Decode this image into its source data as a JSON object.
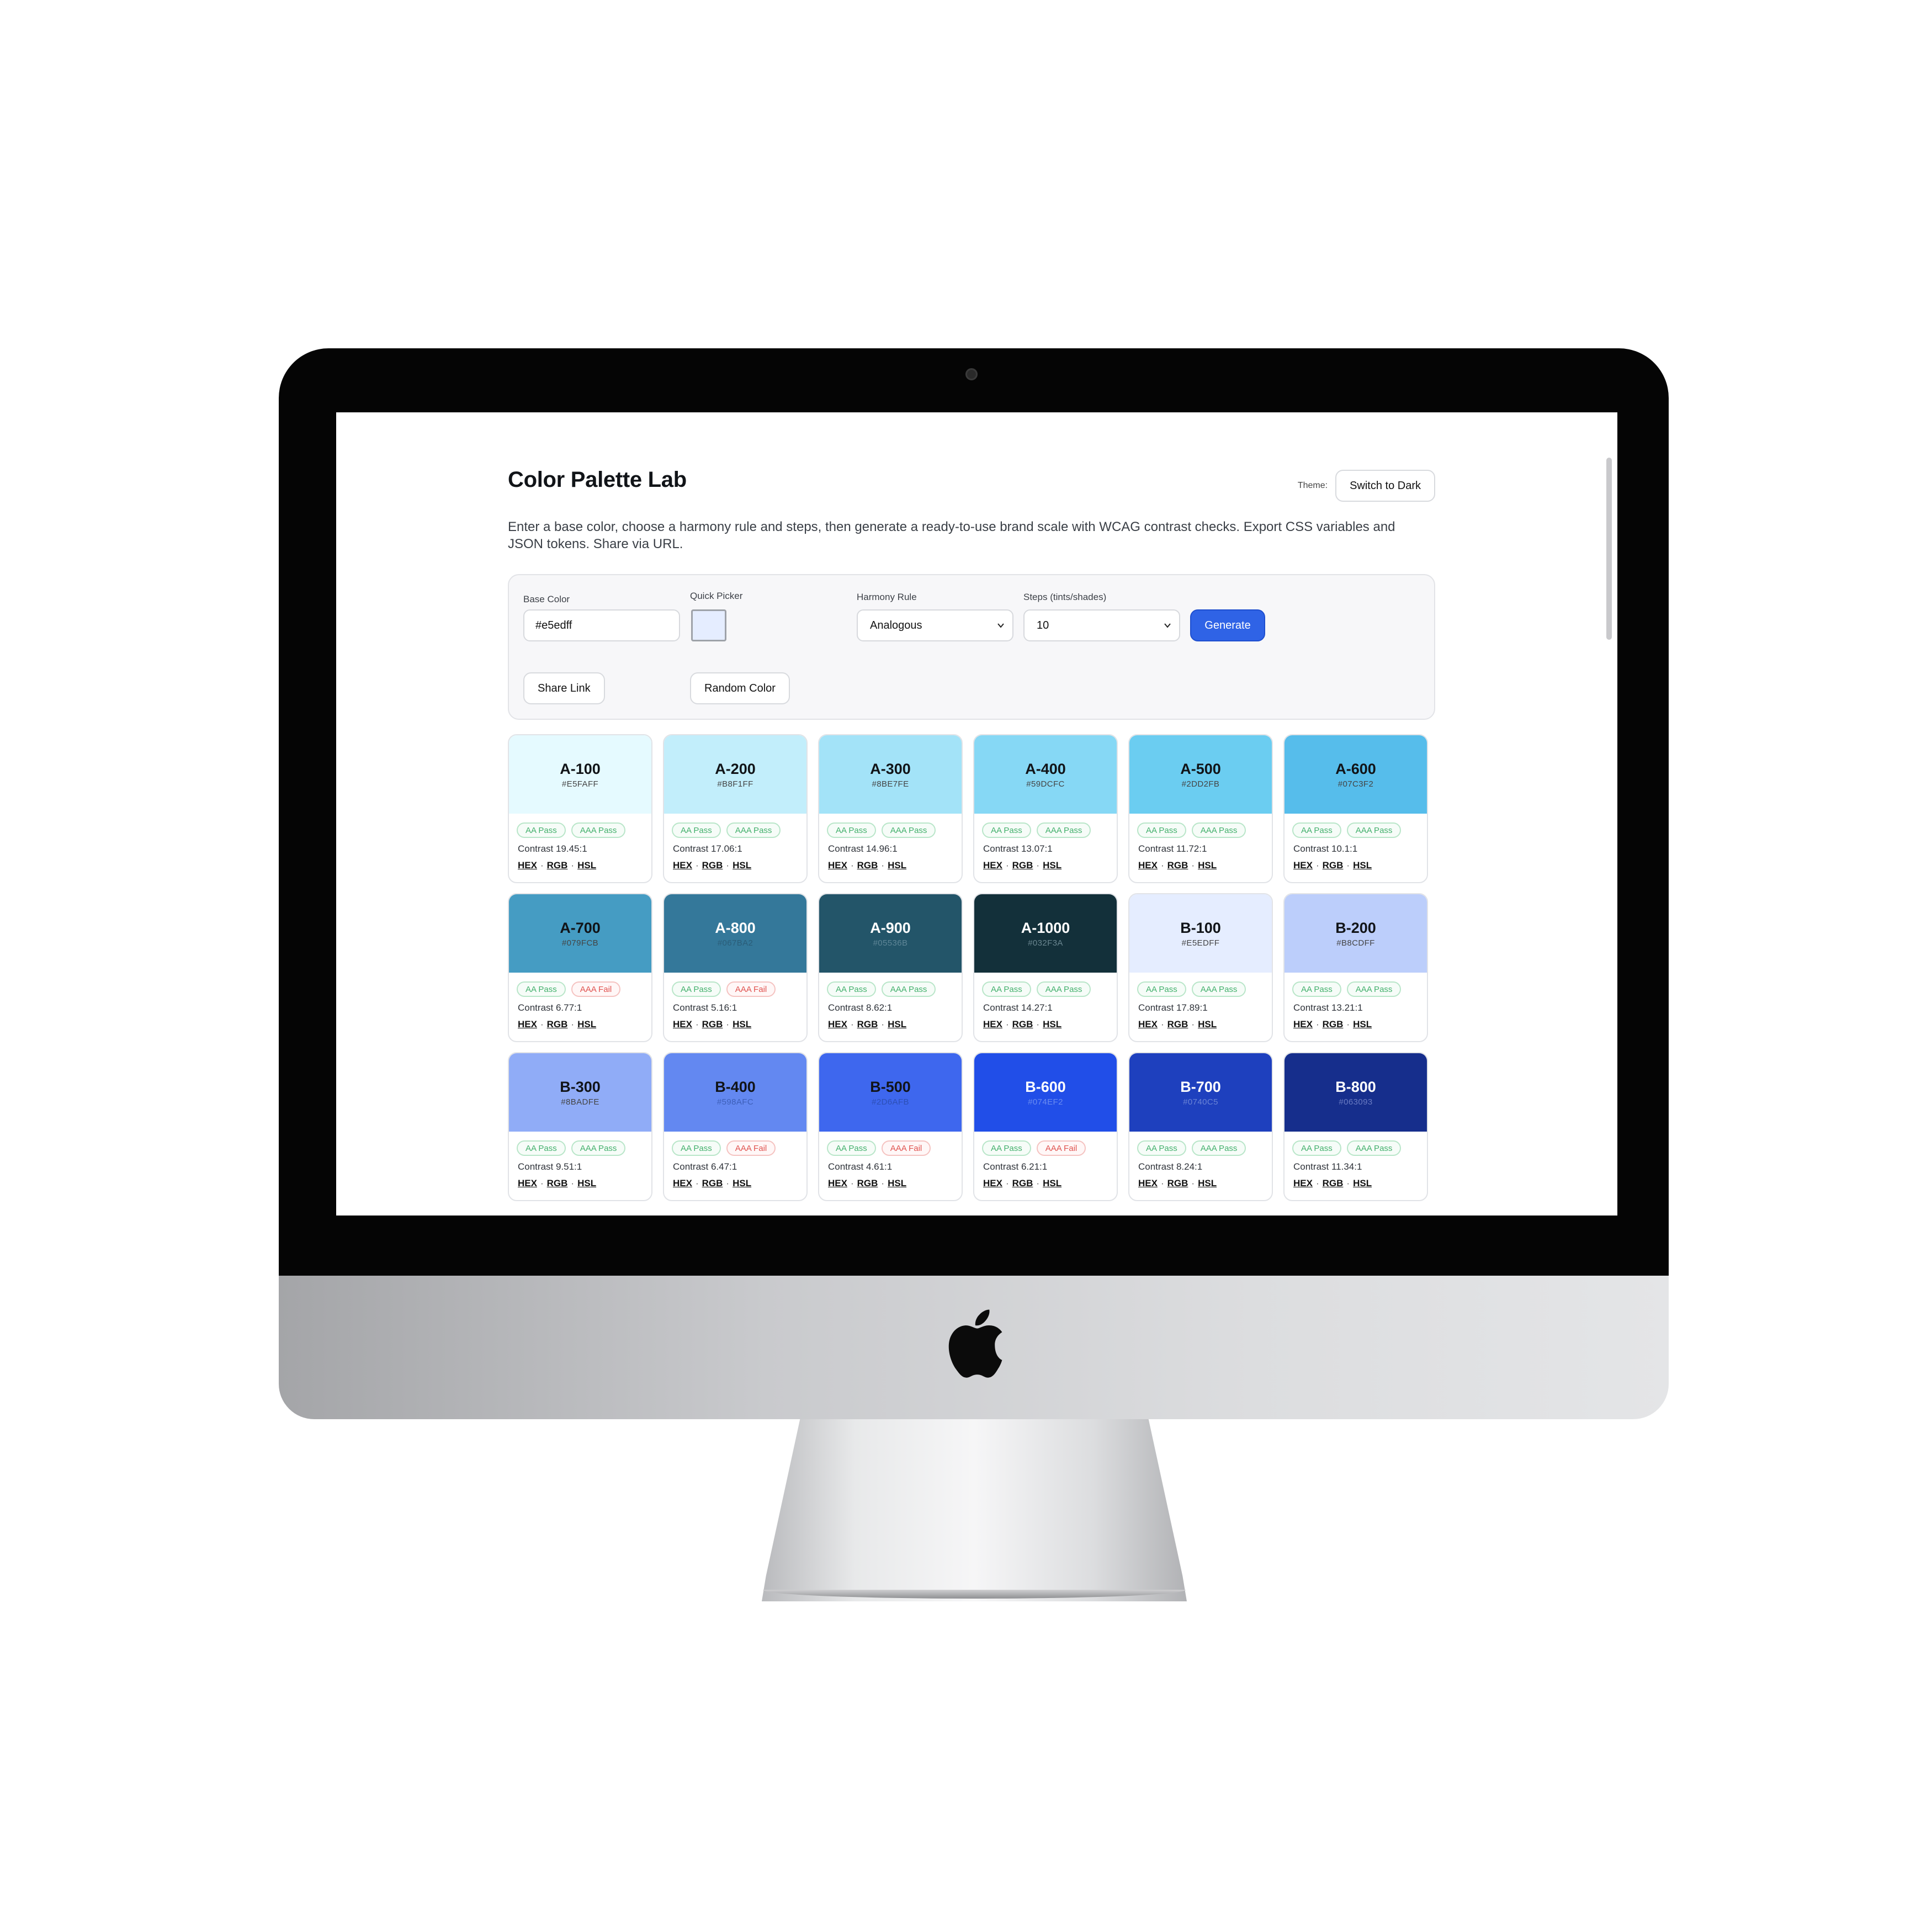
{
  "app": {
    "title": "Color Palette Lab",
    "theme_label": "Theme:",
    "theme_button": "Switch to Dark",
    "description": "Enter a base color, choose a harmony rule and steps, then generate a ready-to-use brand scale with WCAG contrast checks. Export CSS variables and JSON tokens. Share via URL."
  },
  "controls": {
    "base_color_label": "Base Color",
    "base_color_value": "#e5edff",
    "quick_picker_label": "Quick Picker",
    "quick_picker_color": "#e5edff",
    "harmony_label": "Harmony Rule",
    "harmony_value": "Analogous",
    "steps_label": "Steps (tints/shades)",
    "steps_value": "10",
    "generate_label": "Generate",
    "share_label": "Share Link",
    "random_label": "Random Color"
  },
  "card_formats": {
    "hex": "HEX",
    "rgb": "RGB",
    "hsl": "HSL",
    "separator": "·"
  },
  "cards": [
    {
      "name": "A-100",
      "hex": "#E5FAFF",
      "bg": "#E5FAFF",
      "fg": "#111418",
      "sub": "#444",
      "aa": "AA Pass",
      "aaa": "AAA Pass",
      "aaa_status": "pass",
      "contrast": "Contrast 19.45:1"
    },
    {
      "name": "A-200",
      "hex": "#B8F1FF",
      "bg": "#C2EEFB",
      "fg": "#111418",
      "sub": "#444",
      "aa": "AA Pass",
      "aaa": "AAA Pass",
      "aaa_status": "pass",
      "contrast": "Contrast 17.06:1"
    },
    {
      "name": "A-300",
      "hex": "#8BE7FE",
      "bg": "#A3E3F8",
      "fg": "#111418",
      "sub": "#444",
      "aa": "AA Pass",
      "aaa": "AAA Pass",
      "aaa_status": "pass",
      "contrast": "Contrast 14.96:1"
    },
    {
      "name": "A-400",
      "hex": "#59DCFC",
      "bg": "#86D8F5",
      "fg": "#111418",
      "sub": "#444",
      "aa": "AA Pass",
      "aaa": "AAA Pass",
      "aaa_status": "pass",
      "contrast": "Contrast 13.07:1"
    },
    {
      "name": "A-500",
      "hex": "#2DD2FB",
      "bg": "#6BCDF1",
      "fg": "#111418",
      "sub": "#444",
      "aa": "AA Pass",
      "aaa": "AAA Pass",
      "aaa_status": "pass",
      "contrast": "Contrast 11.72:1"
    },
    {
      "name": "A-600",
      "hex": "#07C3F2",
      "bg": "#56BDEB",
      "fg": "#111418",
      "sub": "#444",
      "aa": "AA Pass",
      "aaa": "AAA Pass",
      "aaa_status": "pass",
      "contrast": "Contrast 10.1:1"
    },
    {
      "name": "A-700",
      "hex": "#079FCB",
      "bg": "#459CC3",
      "fg": "#111418",
      "sub": "#444",
      "aa": "AA Pass",
      "aaa": "AAA Fail",
      "aaa_status": "fail",
      "contrast": "Contrast 6.77:1"
    },
    {
      "name": "A-800",
      "hex": "#067BA2",
      "bg": "#34789A",
      "fg": "#ffffff",
      "sub": "#2a5d78",
      "aa": "AA Pass",
      "aaa": "AAA Fail",
      "aaa_status": "fail",
      "contrast": "Contrast 5.16:1"
    },
    {
      "name": "A-900",
      "hex": "#05536B",
      "bg": "#235569",
      "fg": "#ffffff",
      "sub": "#5e8697",
      "aa": "AA Pass",
      "aaa": "AAA Pass",
      "aaa_status": "pass",
      "contrast": "Contrast 8.62:1"
    },
    {
      "name": "A-1000",
      "hex": "#032F3A",
      "bg": "#13303A",
      "fg": "#ffffff",
      "sub": "#6a8690",
      "aa": "AA Pass",
      "aaa": "AAA Pass",
      "aaa_status": "pass",
      "contrast": "Contrast 14.27:1"
    },
    {
      "name": "B-100",
      "hex": "#E5EDFF",
      "bg": "#E5EDFF",
      "fg": "#111418",
      "sub": "#444",
      "aa": "AA Pass",
      "aaa": "AAA Pass",
      "aaa_status": "pass",
      "contrast": "Contrast 17.89:1"
    },
    {
      "name": "B-200",
      "hex": "#B8CDFF",
      "bg": "#BCCEFB",
      "fg": "#111418",
      "sub": "#444",
      "aa": "AA Pass",
      "aaa": "AAA Pass",
      "aaa_status": "pass",
      "contrast": "Contrast 13.21:1"
    },
    {
      "name": "B-300",
      "hex": "#8BADFE",
      "bg": "#90ACF7",
      "fg": "#111418",
      "sub": "#444",
      "aa": "AA Pass",
      "aaa": "AAA Pass",
      "aaa_status": "pass",
      "contrast": "Contrast 9.51:1"
    },
    {
      "name": "B-400",
      "hex": "#598AFC",
      "bg": "#6388F1",
      "fg": "#111418",
      "sub": "#3d5fb8",
      "aa": "AA Pass",
      "aaa": "AAA Fail",
      "aaa_status": "fail",
      "contrast": "Contrast 6.47:1"
    },
    {
      "name": "B-500",
      "hex": "#2D6AFB",
      "bg": "#3E67EE",
      "fg": "#111418",
      "sub": "#2c4fb6",
      "aa": "AA Pass",
      "aaa": "AAA Fail",
      "aaa_status": "fail",
      "contrast": "Contrast 4.61:1"
    },
    {
      "name": "B-600",
      "hex": "#074EF2",
      "bg": "#214EE8",
      "fg": "#ffffff",
      "sub": "#6a8cf0",
      "aa": "AA Pass",
      "aaa": "AAA Fail",
      "aaa_status": "fail",
      "contrast": "Contrast 6.21:1"
    },
    {
      "name": "B-700",
      "hex": "#0740C5",
      "bg": "#1E40BE",
      "fg": "#ffffff",
      "sub": "#6a84d6",
      "aa": "AA Pass",
      "aaa": "AAA Pass",
      "aaa_status": "pass",
      "contrast": "Contrast 8.24:1"
    },
    {
      "name": "B-800",
      "hex": "#063093",
      "bg": "#162E8C",
      "fg": "#ffffff",
      "sub": "#6a7bc2",
      "aa": "AA Pass",
      "aaa": "AAA Pass",
      "aaa_status": "pass",
      "contrast": "Contrast 11.34:1"
    }
  ]
}
